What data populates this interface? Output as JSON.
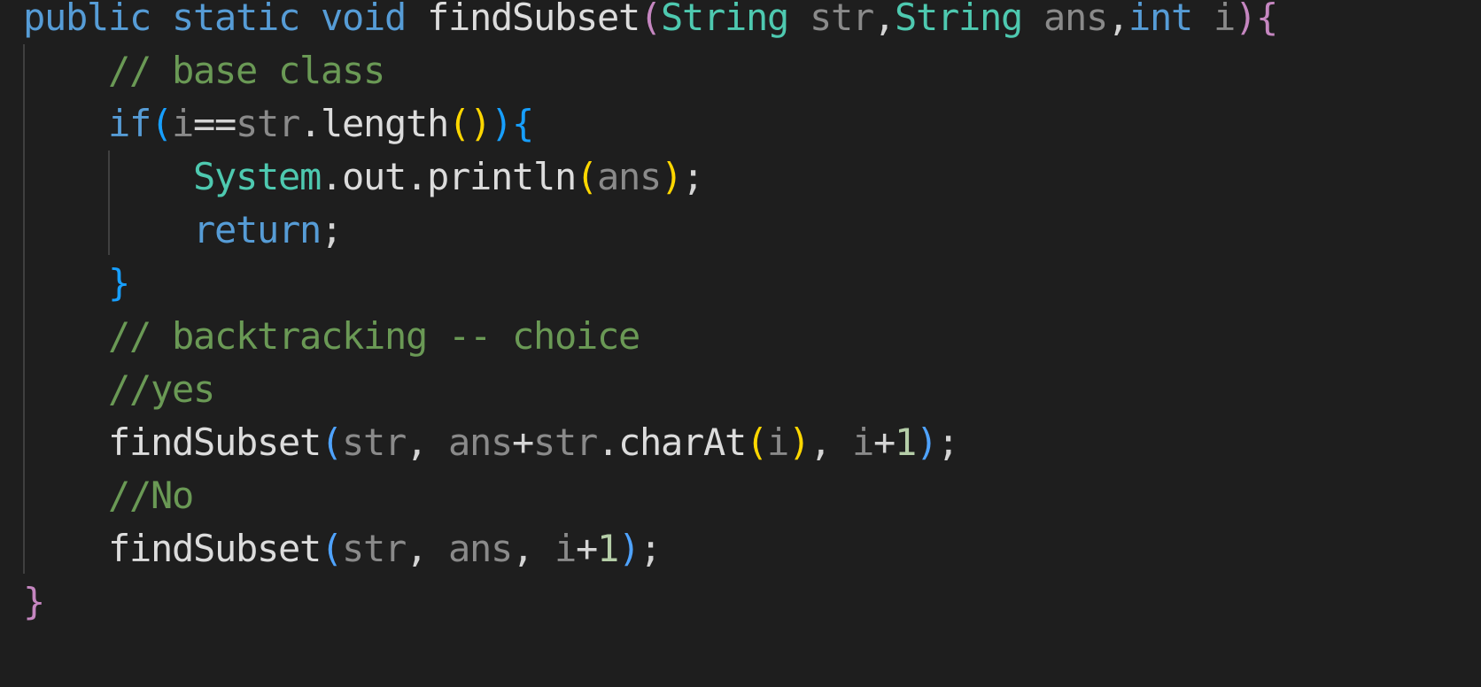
{
  "editor": {
    "language": "Java",
    "theme_colors": {
      "background": "#1e1e1e",
      "keyword": "#569cd6",
      "type": "#4ec9b0",
      "parameter": "#8a8a8a",
      "comment": "#6a9955",
      "number": "#b5cea8",
      "bracket_level_1": "#c586c0",
      "bracket_level_2": "#ffd700",
      "bracket_level_3": "#179fff"
    },
    "lines": [
      [
        {
          "t": "public",
          "c": "kw"
        },
        {
          "t": " ",
          "c": "punc"
        },
        {
          "t": "static",
          "c": "kw"
        },
        {
          "t": " ",
          "c": "punc"
        },
        {
          "t": "void",
          "c": "kw"
        },
        {
          "t": " ",
          "c": "punc"
        },
        {
          "t": "findSubset",
          "c": "fn"
        },
        {
          "t": "(",
          "c": "p1"
        },
        {
          "t": "String",
          "c": "type"
        },
        {
          "t": " ",
          "c": "punc"
        },
        {
          "t": "str",
          "c": "param"
        },
        {
          "t": ",",
          "c": "punc"
        },
        {
          "t": "String",
          "c": "type"
        },
        {
          "t": " ",
          "c": "punc"
        },
        {
          "t": "ans",
          "c": "param"
        },
        {
          "t": ",",
          "c": "punc"
        },
        {
          "t": "int",
          "c": "kw"
        },
        {
          "t": " ",
          "c": "punc"
        },
        {
          "t": "i",
          "c": "param"
        },
        {
          "t": ")",
          "c": "p1"
        },
        {
          "t": "{",
          "c": "p1"
        }
      ],
      [
        {
          "t": "    ",
          "c": "punc"
        },
        {
          "t": "// base class",
          "c": "comment"
        }
      ],
      [
        {
          "t": "    ",
          "c": "punc"
        },
        {
          "t": "if",
          "c": "kw"
        },
        {
          "t": "(",
          "c": "p3"
        },
        {
          "t": "i",
          "c": "param"
        },
        {
          "t": "==",
          "c": "punc"
        },
        {
          "t": "str",
          "c": "param"
        },
        {
          "t": ".",
          "c": "punc"
        },
        {
          "t": "length",
          "c": "fn"
        },
        {
          "t": "()",
          "c": "p2"
        },
        {
          "t": ")",
          "c": "p3"
        },
        {
          "t": "{",
          "c": "p3"
        }
      ],
      [
        {
          "t": "        ",
          "c": "punc"
        },
        {
          "t": "System",
          "c": "type"
        },
        {
          "t": ".",
          "c": "punc"
        },
        {
          "t": "out",
          "c": "fn"
        },
        {
          "t": ".",
          "c": "punc"
        },
        {
          "t": "println",
          "c": "fn"
        },
        {
          "t": "(",
          "c": "p2"
        },
        {
          "t": "ans",
          "c": "param"
        },
        {
          "t": ")",
          "c": "p2"
        },
        {
          "t": ";",
          "c": "punc"
        }
      ],
      [
        {
          "t": "        ",
          "c": "punc"
        },
        {
          "t": "return",
          "c": "kw"
        },
        {
          "t": ";",
          "c": "punc"
        }
      ],
      [
        {
          "t": "    ",
          "c": "punc"
        },
        {
          "t": "}",
          "c": "p3"
        }
      ],
      [
        {
          "t": "    ",
          "c": "punc"
        },
        {
          "t": "// backtracking -- choice",
          "c": "comment"
        }
      ],
      [
        {
          "t": "    ",
          "c": "punc"
        },
        {
          "t": "//yes",
          "c": "comment"
        }
      ],
      [
        {
          "t": "    ",
          "c": "punc"
        },
        {
          "t": "findSubset",
          "c": "fn"
        },
        {
          "t": "(",
          "c": "p3b"
        },
        {
          "t": "str",
          "c": "param"
        },
        {
          "t": ", ",
          "c": "punc"
        },
        {
          "t": "ans",
          "c": "param"
        },
        {
          "t": "+",
          "c": "punc"
        },
        {
          "t": "str",
          "c": "param"
        },
        {
          "t": ".",
          "c": "punc"
        },
        {
          "t": "charAt",
          "c": "fn"
        },
        {
          "t": "(",
          "c": "p2"
        },
        {
          "t": "i",
          "c": "param"
        },
        {
          "t": ")",
          "c": "p2"
        },
        {
          "t": ", ",
          "c": "punc"
        },
        {
          "t": "i",
          "c": "param"
        },
        {
          "t": "+",
          "c": "punc"
        },
        {
          "t": "1",
          "c": "num"
        },
        {
          "t": ")",
          "c": "p3b"
        },
        {
          "t": ";",
          "c": "punc"
        }
      ],
      [
        {
          "t": "    ",
          "c": "punc"
        },
        {
          "t": "//No",
          "c": "comment"
        }
      ],
      [
        {
          "t": "    ",
          "c": "punc"
        },
        {
          "t": "findSubset",
          "c": "fn"
        },
        {
          "t": "(",
          "c": "p3b"
        },
        {
          "t": "str",
          "c": "param"
        },
        {
          "t": ", ",
          "c": "punc"
        },
        {
          "t": "ans",
          "c": "param"
        },
        {
          "t": ", ",
          "c": "punc"
        },
        {
          "t": "i",
          "c": "param"
        },
        {
          "t": "+",
          "c": "punc"
        },
        {
          "t": "1",
          "c": "num"
        },
        {
          "t": ")",
          "c": "p3b"
        },
        {
          "t": ";",
          "c": "punc"
        }
      ],
      [
        {
          "t": "}",
          "c": "p1"
        }
      ]
    ]
  }
}
